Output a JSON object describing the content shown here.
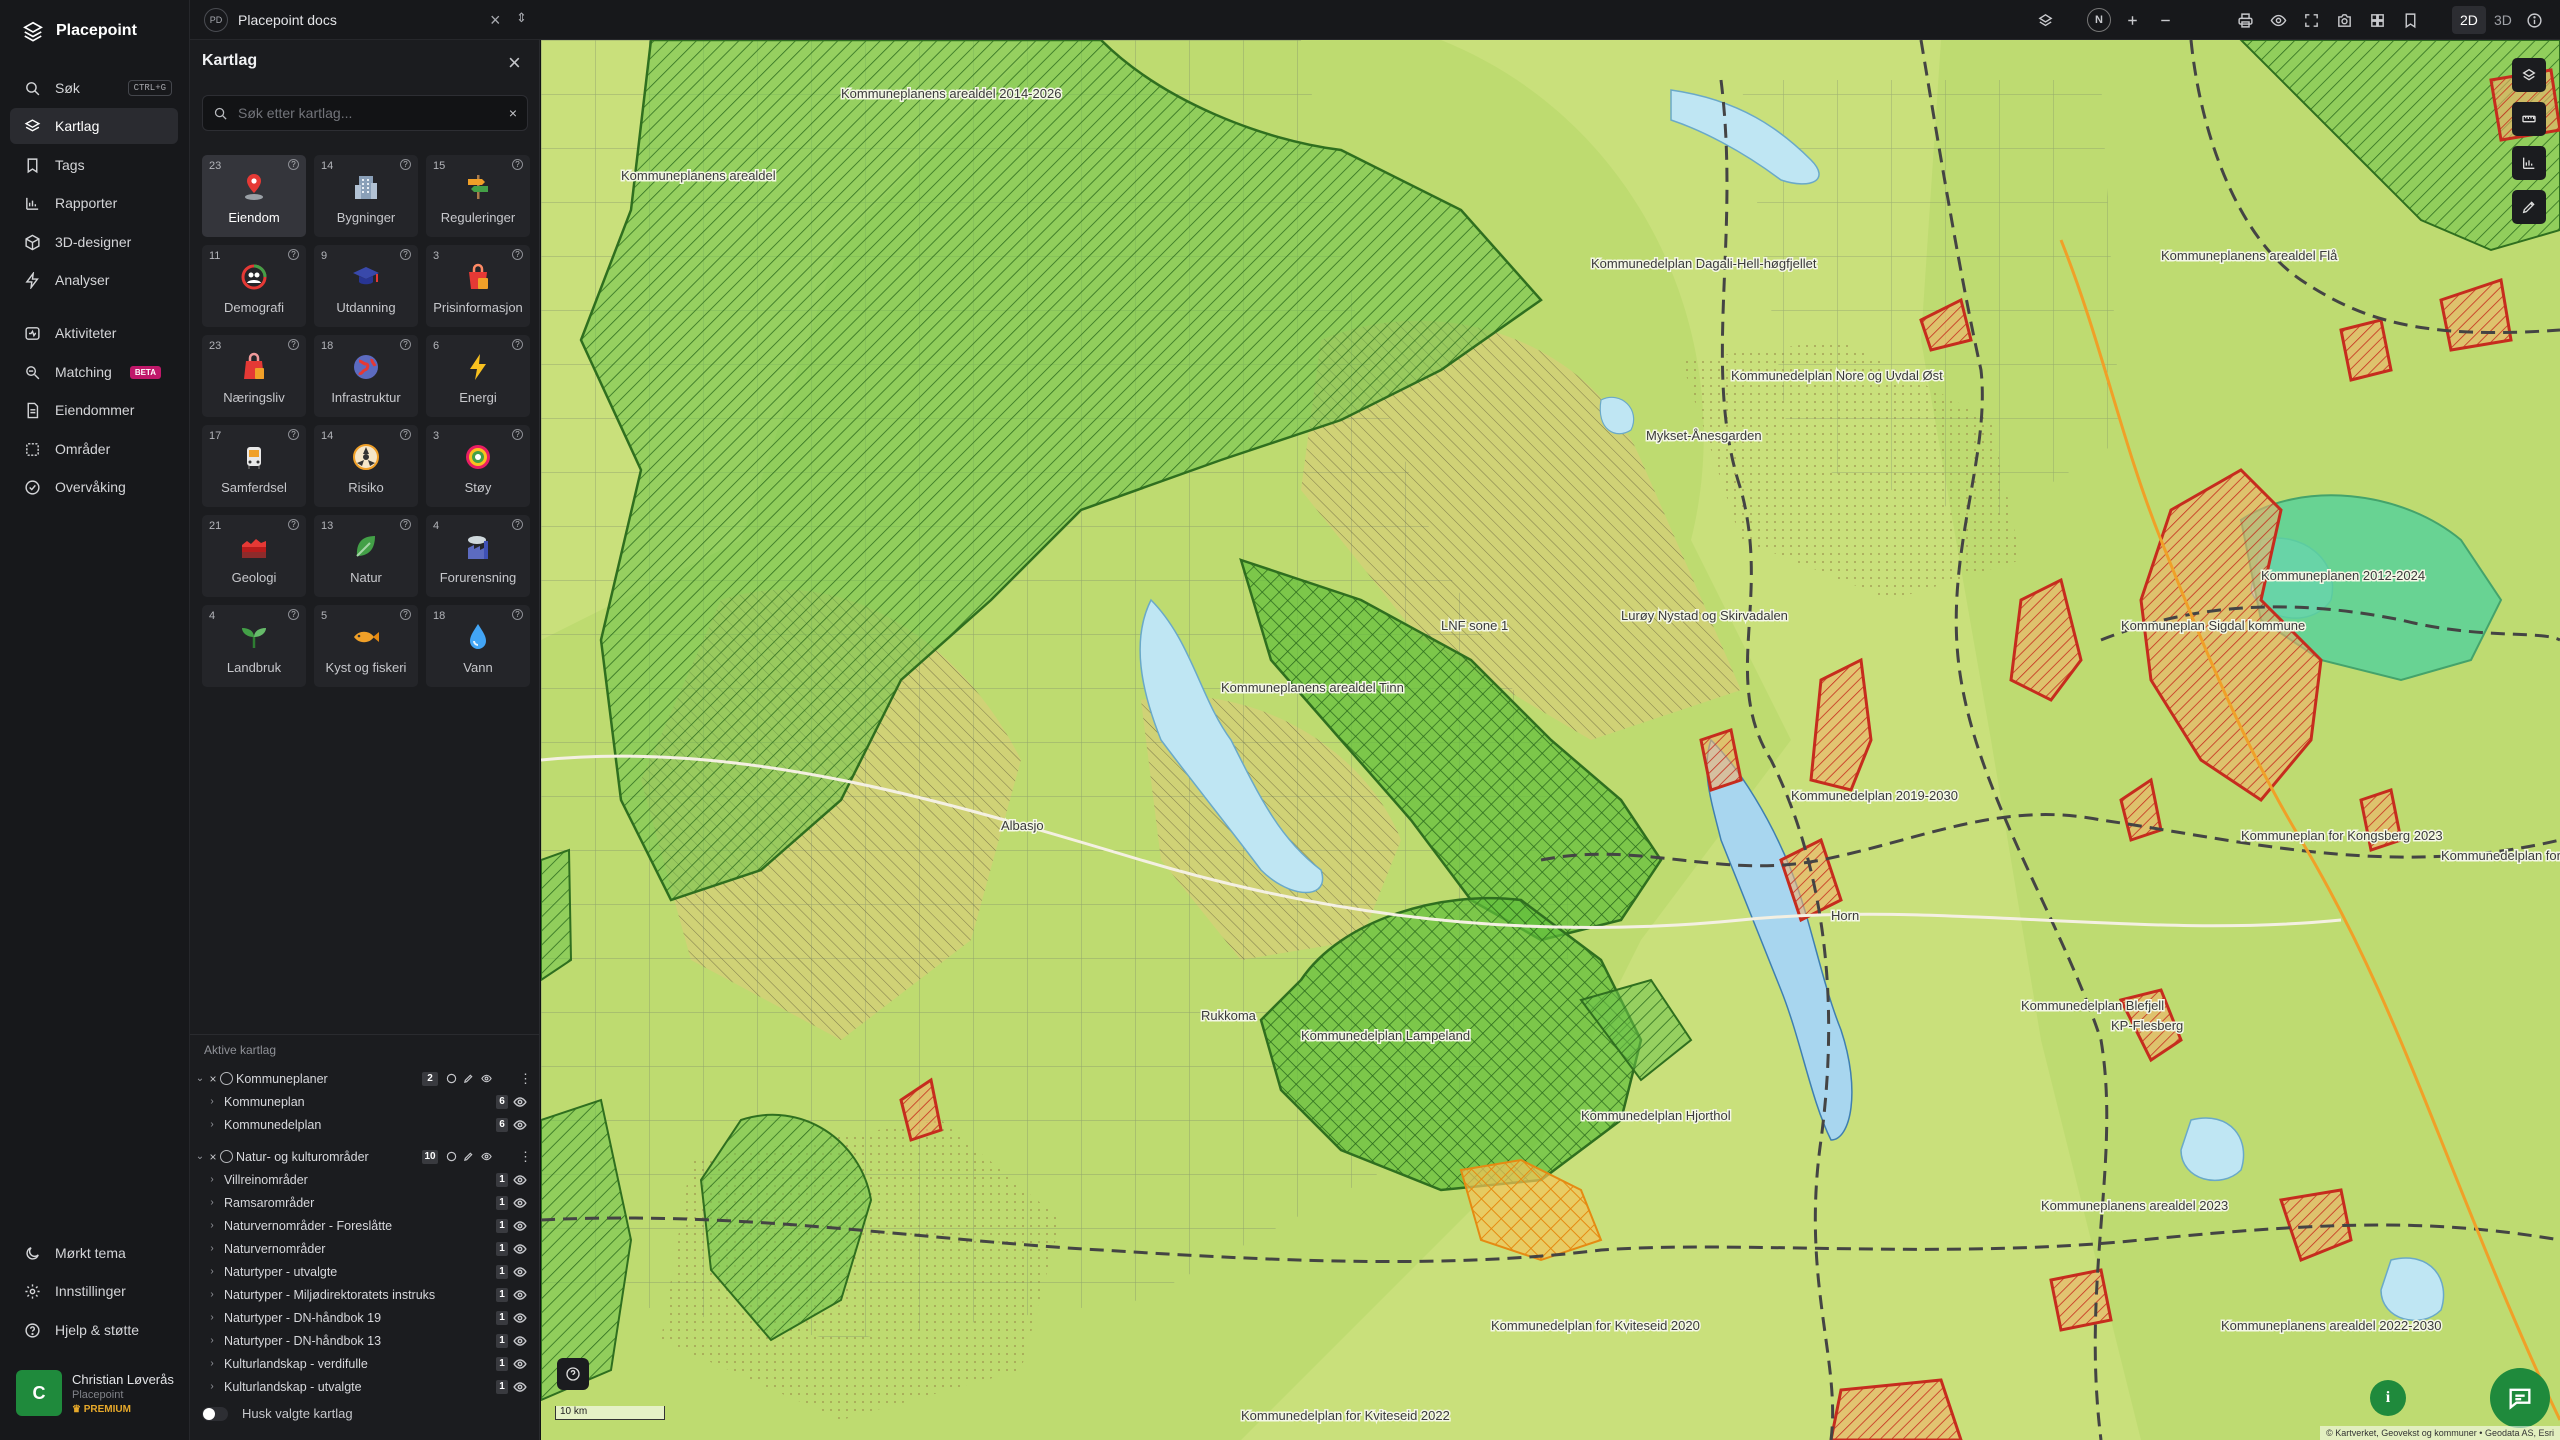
{
  "app": {
    "name": "Placepoint"
  },
  "nav": {
    "items": [
      {
        "label": "Søk",
        "icon": "search-icon",
        "shortcut": "CTRL+G"
      },
      {
        "label": "Kartlag",
        "icon": "layers-icon",
        "active": true
      },
      {
        "label": "Tags",
        "icon": "bookmark-icon"
      },
      {
        "label": "Rapporter",
        "icon": "bar-chart-icon"
      },
      {
        "label": "3D-designer",
        "icon": "cube-icon"
      },
      {
        "label": "Analyser",
        "icon": "lightning-icon"
      },
      {
        "label": "Aktiviteter",
        "icon": "activity-icon"
      },
      {
        "label": "Matching",
        "icon": "matching-icon",
        "badge": "BETA"
      },
      {
        "label": "Eiendommer",
        "icon": "document-icon"
      },
      {
        "label": "Områder",
        "icon": "area-icon"
      },
      {
        "label": "Overvåking",
        "icon": "monitor-icon"
      }
    ],
    "bottom": [
      {
        "label": "Mørkt tema",
        "icon": "moon-icon"
      },
      {
        "label": "Innstillinger",
        "icon": "gear-icon"
      },
      {
        "label": "Hjelp & støtte",
        "icon": "help-icon"
      }
    ],
    "user": {
      "initial": "C",
      "name": "Christian Løverås",
      "org": "Placepoint",
      "plan": "PREMIUM"
    }
  },
  "topbar": {
    "workspace_badge": "PD",
    "workspace": "Placepoint docs",
    "compass": "N",
    "modes": [
      "2D",
      "3D"
    ],
    "active_mode": "2D"
  },
  "panel": {
    "title": "Kartlag",
    "search_placeholder": "Søk etter kartlag...",
    "categories": [
      {
        "label": "Eiendom",
        "count": "23",
        "icon": "pin-icon",
        "active": true
      },
      {
        "label": "Bygninger",
        "count": "14",
        "icon": "building-icon"
      },
      {
        "label": "Reguleringer",
        "count": "15",
        "icon": "signpost-icon"
      },
      {
        "label": "Demografi",
        "count": "11",
        "icon": "demography-icon"
      },
      {
        "label": "Utdanning",
        "count": "9",
        "icon": "graduation-icon"
      },
      {
        "label": "Prisinformasjon",
        "count": "3",
        "icon": "shopping-bag-icon"
      },
      {
        "label": "Næringsliv",
        "count": "23",
        "icon": "briefcase-icon"
      },
      {
        "label": "Infrastruktur",
        "count": "18",
        "icon": "globe-icon"
      },
      {
        "label": "Energi",
        "count": "6",
        "icon": "lightning-icon"
      },
      {
        "label": "Samferdsel",
        "count": "17",
        "icon": "bus-icon"
      },
      {
        "label": "Risiko",
        "count": "14",
        "icon": "hazard-icon"
      },
      {
        "label": "Støy",
        "count": "3",
        "icon": "noise-icon"
      },
      {
        "label": "Geologi",
        "count": "21",
        "icon": "geology-icon"
      },
      {
        "label": "Natur",
        "count": "13",
        "icon": "leaf-icon"
      },
      {
        "label": "Forurensning",
        "count": "4",
        "icon": "factory-icon"
      },
      {
        "label": "Landbruk",
        "count": "4",
        "icon": "sprout-icon"
      },
      {
        "label": "Kyst og fiskeri",
        "count": "5",
        "icon": "fish-icon"
      },
      {
        "label": "Vann",
        "count": "18",
        "icon": "water-drop-icon"
      }
    ],
    "active_title": "Aktive kartlag",
    "groups": [
      {
        "name": "Kommuneplaner",
        "count": "2",
        "layers": [
          {
            "name": "Kommuneplan",
            "count": "6"
          },
          {
            "name": "Kommunedelplan",
            "count": "6"
          }
        ]
      },
      {
        "name": "Natur- og kulturområder",
        "count": "10",
        "layers": [
          {
            "name": "Villreinområder",
            "count": "1"
          },
          {
            "name": "Ramsarområder",
            "count": "1"
          },
          {
            "name": "Naturvernområder - Foreslåtte",
            "count": "1"
          },
          {
            "name": "Naturvernområder",
            "count": "1"
          },
          {
            "name": "Naturtyper - utvalgte",
            "count": "1"
          },
          {
            "name": "Naturtyper - Miljødirektoratets instruks",
            "count": "1"
          },
          {
            "name": "Naturtyper - DN-håndbok 19",
            "count": "1"
          },
          {
            "name": "Naturtyper - DN-håndbok 13",
            "count": "1"
          },
          {
            "name": "Kulturlandskap - verdifulle",
            "count": "1"
          },
          {
            "name": "Kulturlandskap - utvalgte",
            "count": "1"
          }
        ]
      }
    ],
    "remember_label": "Husk valgte kartlag"
  },
  "map": {
    "scale_label": "10 km",
    "attribution": "© Kartverket, Geovekst og kommuner • Geodata AS, Esri",
    "colors": {
      "background": "#c7df78",
      "forest": "#5fbf3a",
      "protected_outline": "#2f6f1f",
      "red_areas": "#d0261e",
      "water": "#bfe6f3",
      "orange": "#f0a028"
    },
    "labels": [
      "Kommuneplanens arealdel 2014-2026",
      "Kommuneplanens arealdel",
      "Kommunedelplan Dagali-Hell-høgfjellet",
      "Kommunedelplan Nore og Uvdal Øst",
      "Mykset-Ånesgarden",
      "Kommuneplanens arealdel Flå",
      "Kommuneplan Sigdal kommune",
      "Kommuneplanen 2012-2024",
      "Kommunedelplan Lampeland",
      "Kommunedelplan Blefjell",
      "Kommuneplan for Kongsberg 2023",
      "Kommunedelplan for Kviteseid 2022",
      "Kommuneplanens arealdel 2023",
      "Kommunedelplan for Kobbes",
      "Kommunedelplan Hjorthol",
      "Rukkoma",
      "Kommuneplanens arealdel Tinn",
      "LNF sone 1",
      "Lurøy Nystad og Skirvadalen",
      "Kommunedelplan 2019-2030",
      "KP-Flesberg",
      "Kommuneplanens arealdel 2022-2030",
      "Kommunedelplan for Kviteseid 2020",
      "Albasjo",
      "Horn"
    ]
  }
}
